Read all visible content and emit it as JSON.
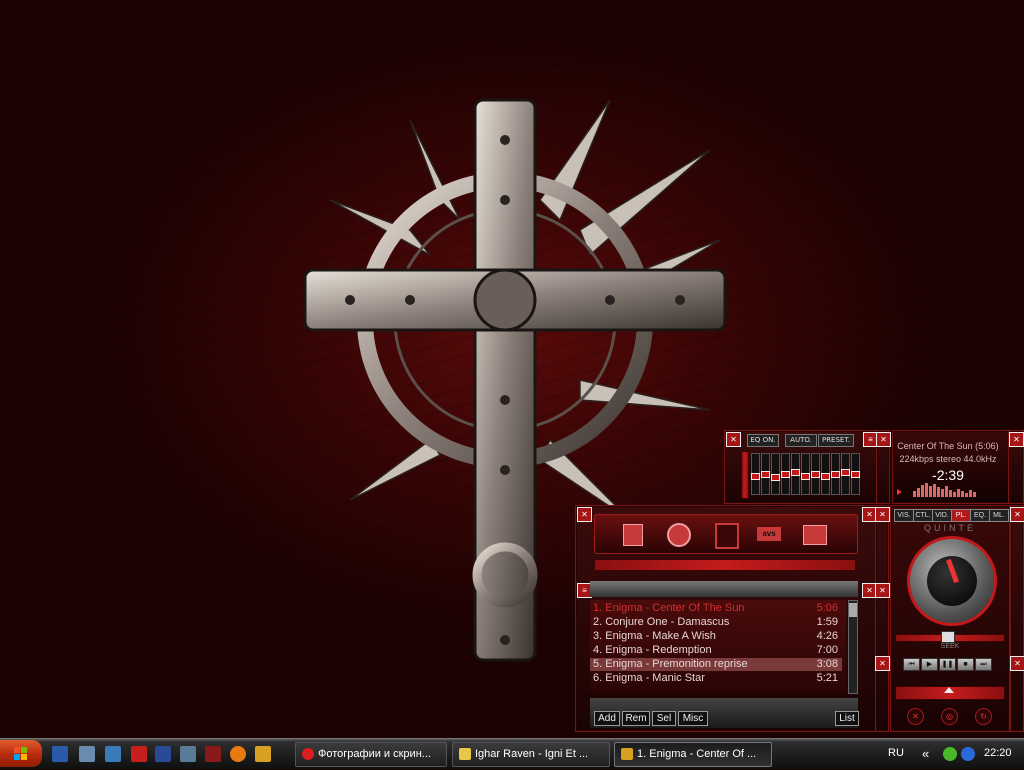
{
  "winamp": {
    "equalizer": {
      "on_label": "EQ ON.",
      "auto_label": "AUTO.",
      "presets_label": "PRESET.",
      "bands": [
        0.45,
        0.5,
        0.4,
        0.5,
        0.55,
        0.45,
        0.5,
        0.45,
        0.5,
        0.55,
        0.5
      ]
    },
    "info": {
      "title_line": "Center Of The Sun (5:06)",
      "format_line": "224kbps stereo 44.0kHz",
      "time": "-2:39"
    },
    "tabs": [
      {
        "label": "VIS."
      },
      {
        "label": "CTL."
      },
      {
        "label": "VID."
      },
      {
        "label": "PL."
      },
      {
        "label": "EQ."
      },
      {
        "label": "ML."
      }
    ],
    "brand": "QUINTE",
    "seek_label": "SEEK",
    "playlist": {
      "items": [
        {
          "title": "1. Enigma - Center Of The Sun",
          "duration": "5:06"
        },
        {
          "title": "2. Conjure One - Damascus",
          "duration": "1:59"
        },
        {
          "title": "3. Enigma - Make A Wish",
          "duration": "4:26"
        },
        {
          "title": "4. Enigma - Redemption",
          "duration": "7:00"
        },
        {
          "title": "5. Enigma - Premonition reprise",
          "duration": "3:08"
        },
        {
          "title": "6. Enigma - Manic Star",
          "duration": "5:21"
        }
      ],
      "buttons": {
        "add": "Add",
        "rem": "Rem",
        "sel": "Sel",
        "misc": "Misc",
        "list": "List"
      }
    }
  },
  "taskbar": {
    "tasks": [
      {
        "label": "Фотографии и скрин..."
      },
      {
        "label": "Ighar Raven - Igni Et ..."
      },
      {
        "label": "1. Enigma - Center Of ..."
      }
    ],
    "language": "RU",
    "chevron": "«",
    "clock": "22:20",
    "colors": {
      "accent": "#c41c1c"
    }
  }
}
